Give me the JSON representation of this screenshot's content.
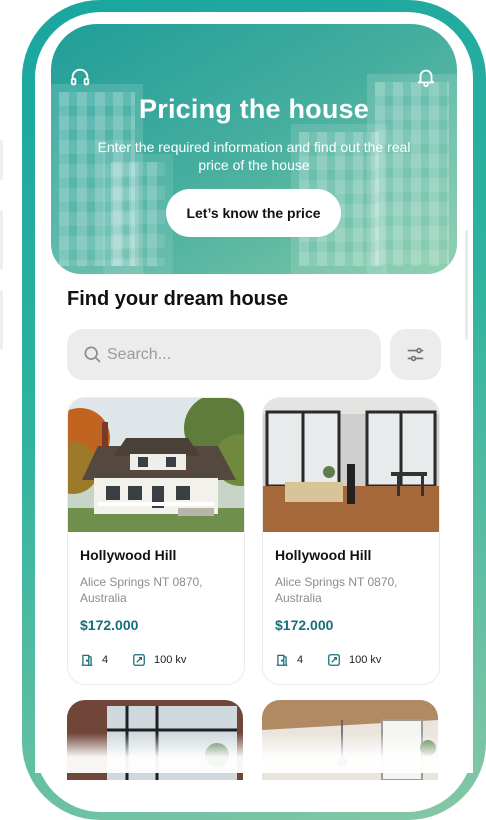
{
  "hero": {
    "title": "Pricing the house",
    "subtitle": "Enter the required information and find out the real price of the house",
    "button_label": "Let’s know the price"
  },
  "section_title": "Find your dream house",
  "search": {
    "placeholder": "Search..."
  },
  "listings": [
    {
      "name": "Hollywood Hill",
      "address": "Alice Springs NT 0870, Australia",
      "price": "$172.000",
      "rooms": "4",
      "area": "100 kv"
    },
    {
      "name": "Hollywood Hill",
      "address": "Alice Springs NT 0870, Australia",
      "price": "$172.000",
      "rooms": "4",
      "area": "100 kv"
    }
  ],
  "icons": {
    "support": "headset-icon",
    "notifications": "bell-icon",
    "search": "search-icon",
    "filter": "sliders-icon",
    "rooms": "door-icon",
    "area": "area-icon"
  },
  "colors": {
    "accent": "#1f9e98",
    "accent_light": "#7fc8a5",
    "price": "#166f7a"
  }
}
